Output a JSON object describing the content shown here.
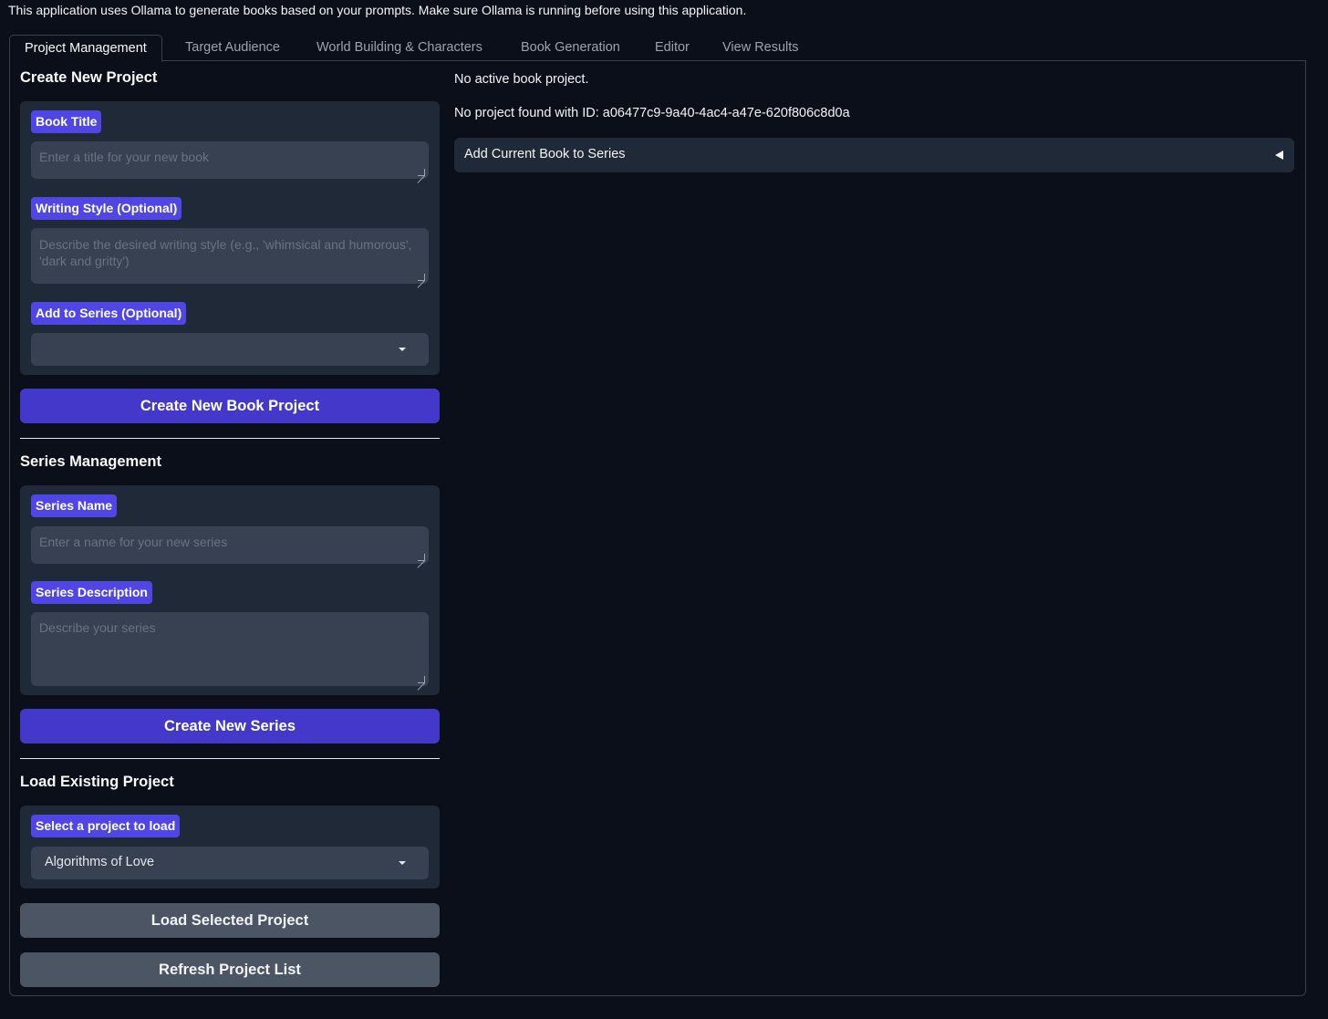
{
  "notice": "This application uses Ollama to generate books based on your prompts. Make sure Ollama is running before using this application.",
  "tabs": [
    {
      "label": "Project Management",
      "active": true
    },
    {
      "label": "Target Audience"
    },
    {
      "label": "World Building & Characters"
    },
    {
      "label": "Book Generation"
    },
    {
      "label": "Editor"
    },
    {
      "label": "View Results"
    }
  ],
  "create_project": {
    "title": "Create New Project",
    "book_title_label": "Book Title",
    "book_title_placeholder": "Enter a title for your new book",
    "book_title_value": "",
    "writing_style_label": "Writing Style (Optional)",
    "writing_style_placeholder": "Describe the desired writing style (e.g., 'whimsical and humorous', 'dark and gritty')",
    "writing_style_value": "",
    "series_label": "Add to Series (Optional)",
    "series_selected": "",
    "create_button": "Create New Book Project"
  },
  "series_management": {
    "title": "Series Management",
    "name_label": "Series Name",
    "name_placeholder": "Enter a name for your new series",
    "name_value": "",
    "description_label": "Series Description",
    "description_placeholder": "Describe your series",
    "description_value": "",
    "create_button": "Create New Series"
  },
  "load_project": {
    "title": "Load Existing Project",
    "select_label": "Select a project to load",
    "selected": "Algorithms of Love",
    "load_button": "Load Selected Project",
    "refresh_button": "Refresh Project List"
  },
  "status": {
    "active_book": "No active book project.",
    "not_found": "No project found with ID: a06477c9-9a40-4ac4-a47e-620f806c8d0a"
  },
  "accordion": {
    "label": "Add Current Book to Series",
    "expanded": false
  },
  "colors": {
    "background": "#0b0f19",
    "accent": "#4f46e5",
    "primary_button": "#4338ca",
    "secondary_button": "#4b5563",
    "group_bg": "#1f2937"
  }
}
